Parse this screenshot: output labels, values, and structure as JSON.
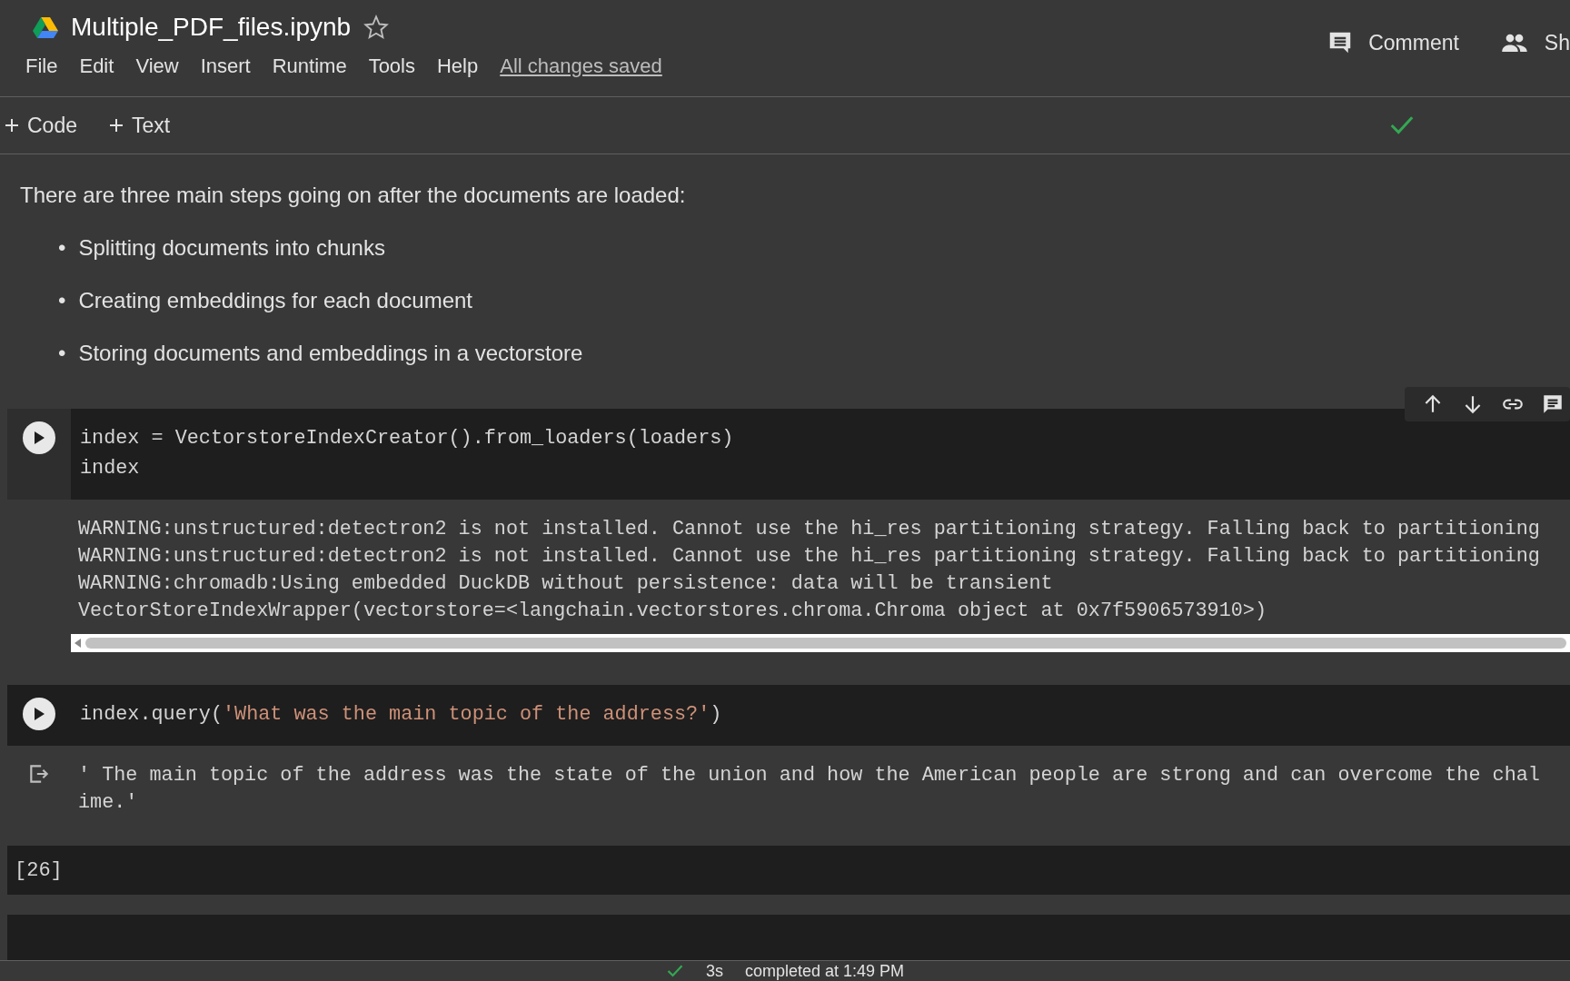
{
  "notebook": {
    "title": "Multiple_PDF_files.ipynb",
    "starred": false
  },
  "header_actions": [
    {
      "kind": "comment",
      "label": "Comment"
    },
    {
      "kind": "share",
      "label": "Sh"
    }
  ],
  "menu": [
    "File",
    "Edit",
    "View",
    "Insert",
    "Runtime",
    "Tools",
    "Help"
  ],
  "save_status": "All changes saved",
  "toolbar": [
    {
      "label": "Code"
    },
    {
      "label": "Text"
    }
  ],
  "text_cell": {
    "intro": "There are three main steps going on after the documents are loaded:",
    "bullets": [
      {
        "marker": "•",
        "text": "Splitting documents into chunks"
      },
      {
        "marker": "•",
        "text": "Creating embeddings for each document"
      },
      {
        "marker": "•",
        "text": "Storing documents and embeddings in a vectorstore"
      }
    ]
  },
  "cells": [
    {
      "kind": "code",
      "focused": true,
      "code": [
        [
          {
            "kind": "plain",
            "text": "index = VectorstoreIndexCreator().from_loaders(loaders)"
          }
        ],
        [
          {
            "kind": "plain",
            "text": "index"
          }
        ]
      ],
      "output": {
        "icon": false,
        "scrollbar": true,
        "lines": [
          "WARNING:unstructured:detectron2 is not installed. Cannot use the hi_res partitioning strategy. Falling back to partitioning",
          "WARNING:unstructured:detectron2 is not installed. Cannot use the hi_res partitioning strategy. Falling back to partitioning",
          "WARNING:chromadb:Using embedded DuckDB without persistence: data will be transient",
          "VectorStoreIndexWrapper(vectorstore=<langchain.vectorstores.chroma.Chroma object at 0x7f5906573910>)"
        ]
      }
    },
    {
      "kind": "code",
      "focused": false,
      "code": [
        [
          {
            "kind": "plain",
            "text": "index.query("
          },
          {
            "kind": "string",
            "text": "'What was the main topic of the address?'"
          },
          {
            "kind": "plain",
            "text": ")"
          }
        ]
      ],
      "output": {
        "icon": true,
        "scrollbar": false,
        "lines": [
          "' The main topic of the address was the state of the union and how the American people are strong and can overcome the chal",
          "ime.'"
        ]
      }
    },
    {
      "kind": "empty",
      "label": "[26]"
    },
    {
      "kind": "blank"
    }
  ],
  "status": {
    "duration": "3s",
    "completed": "completed at 1:49 PM"
  }
}
